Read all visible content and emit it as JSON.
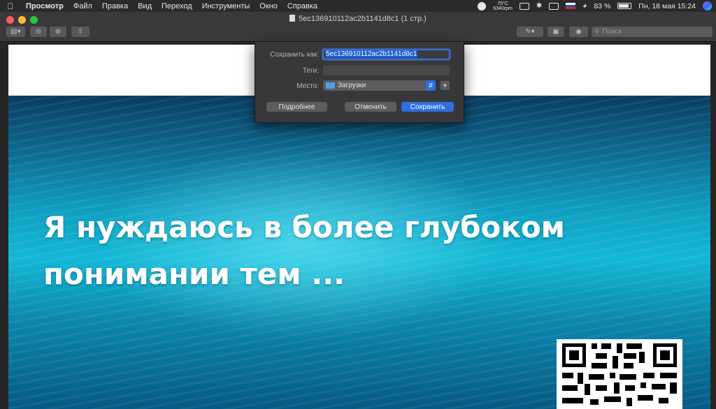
{
  "menubar": {
    "app_name": "Просмотр",
    "items": [
      "Файл",
      "Правка",
      "Вид",
      "Переход",
      "Инструменты",
      "Окно",
      "Справка"
    ],
    "status": {
      "temperature": "75°C",
      "fan": "6340rpm",
      "battery": "83 %",
      "datetime": "Пн, 18 мая  15:24"
    }
  },
  "window": {
    "title": "5ec136910112ac2b1141d8c1 (1 стр.)",
    "search_placeholder": "Поиск",
    "traffic_lights": {
      "close": "#ff5f57",
      "minimize": "#febc2e",
      "zoom": "#28c840"
    }
  },
  "save_sheet": {
    "save_as_label": "Сохранить как:",
    "save_as_value": "5ec136910112ac2b1141d8c1",
    "tags_label": "Теги:",
    "location_label": "Место:",
    "location_value": "Загрузки",
    "details_button": "Подробнее",
    "cancel_button": "Отменить",
    "save_button": "Сохранить",
    "accent_color": "#2f6fe0"
  },
  "slide": {
    "line1": "Я нуждаюсь в более глубоком",
    "line2": "понимании тем ..."
  },
  "icons": [
    "apple-icon",
    "sidebar-icon",
    "zoom-out-icon",
    "zoom-in-icon",
    "share-icon",
    "markup-pen-icon",
    "toolbox-icon",
    "annotate-icon",
    "search-icon",
    "folder-icon",
    "wifi-icon",
    "battery-icon",
    "siri-icon",
    "qr-code-icon"
  ]
}
